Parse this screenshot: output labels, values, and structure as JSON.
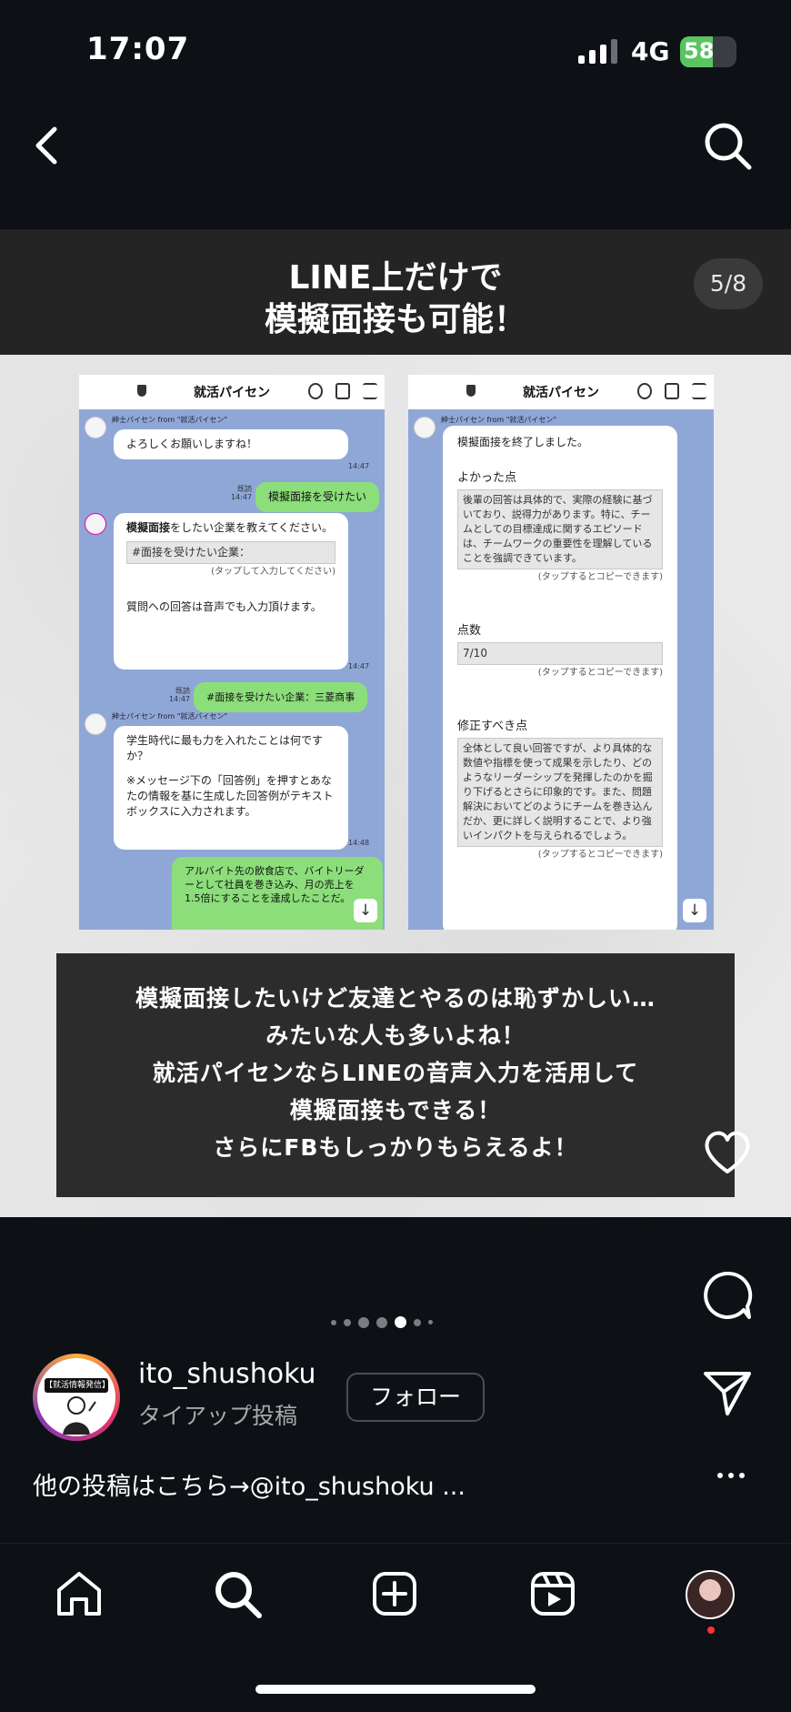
{
  "status_bar": {
    "time": "17:07",
    "network": "4G",
    "battery": "58"
  },
  "slide": {
    "title_lines": [
      "LINE上だけで",
      "模擬面接も可能！"
    ],
    "counter": "5/8",
    "left_phone": {
      "app_name": "就活パイセン",
      "sender1": "紳士パイセン from \"就活パイセン\"",
      "msg1": "よろしくお願いしますね！",
      "time1": "14:47",
      "read_label": "既読",
      "user_msg1": "模擬面接を受けたい",
      "time_user1": "14:47",
      "bot_msg_intro_bold": "模擬面接",
      "bot_msg_intro_rest": "をしたい企業を教えてください。",
      "bot_field": "#面接を受けたい企業：",
      "tap_note": "(タップして入力してください)",
      "bot_msg_voice": "質問への回答は音声でも入力頂けます。",
      "time2": "14:47",
      "user_msg2": "#面接を受けたい企業：三菱商事",
      "time_user2": "14:47",
      "sender2": "紳士パイセン from \"就活パイセン\"",
      "question": "学生時代に最も力を入れたことは何ですか？",
      "question_note": "※メッセージ下の「回答例」を押すとあなたの情報を基に生成した回答例がテキストボックスに入力されます。",
      "time3": "14:48",
      "answer": "アルバイト先の飲食店で、バイトリーダーとして社員を巻き込み、月の売上を1.5倍にすることを達成したことだ。"
    },
    "right_phone": {
      "app_name": "就活パイセン",
      "sender": "紳士パイセン from \"就活パイセン\"",
      "end_msg": "模擬面接を終了しました。",
      "good_label": "よかった点",
      "good_text": "後輩の回答は具体的で、実際の経験に基づいており、説得力があります。特に、チームとしての目標達成に関するエピソードは、チームワークの重要性を理解していることを強調できています。",
      "copy_note": "(タップするとコピーできます)",
      "score_label": "点数",
      "score_value": "7/10",
      "fix_label": "修正すべき点",
      "fix_text": "全体として良い回答ですが、より具体的な数値や指標を使って成果を示したり、どのようなリーダーシップを発揮したのかを掘り下げるとさらに印象的です。また、問題解決においてどのようにチームを巻き込んだか、更に詳しく説明することで、より強いインパクトを与えられるでしょう。"
    },
    "caption_lines": [
      "模擬面接したいけど友達とやるのは恥ずかしい…",
      "みたいな人も多いよね！",
      "就活パイセンならLINEの音声入力を活用して",
      "模擬面接もできる！",
      "さらにFBもしっかりもらえるよ！"
    ]
  },
  "author": {
    "username": "ito_shushoku",
    "subtitle": "タイアップ投稿",
    "follow_label": "フォロー",
    "avatar_badge": "【就活情報発信】"
  },
  "post_caption": "他の投稿はこちら→@ito_shushoku ...",
  "carousel": {
    "current": 5,
    "total": 8
  },
  "icons": [
    "back-icon",
    "search-icon",
    "heart-icon",
    "comment-icon",
    "share-icon",
    "more-icon",
    "home-icon",
    "new-post-icon",
    "reels-icon"
  ]
}
